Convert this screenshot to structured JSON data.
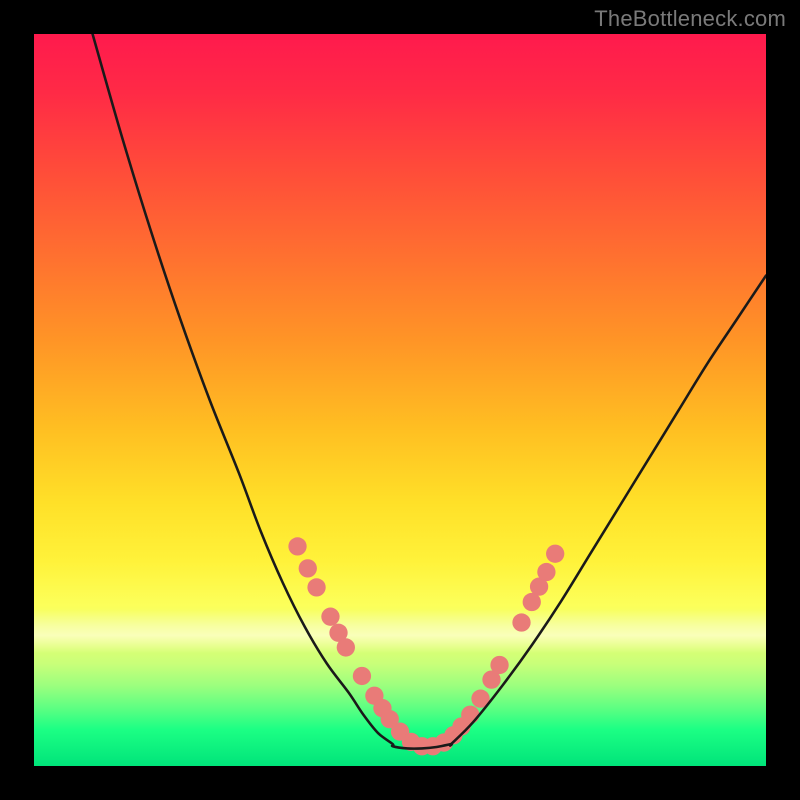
{
  "watermark": "TheBottleneck.com",
  "colors": {
    "dot_fill": "#e97b78",
    "curve_stroke": "#1a1a1a"
  },
  "chart_data": {
    "type": "line",
    "title": "",
    "xlabel": "",
    "ylabel": "",
    "xlim": [
      0,
      100
    ],
    "ylim": [
      0,
      100
    ],
    "note": "No numeric axis ticks or labels are rendered; values are approximate pixel-space percentages of the plot area (0,0 = top-left, 100,100 = bottom-right).",
    "series": [
      {
        "name": "left-curve",
        "x": [
          8,
          12,
          16,
          20,
          24,
          28,
          31,
          34,
          37,
          40,
          43,
          45,
          47,
          49
        ],
        "y": [
          0,
          14,
          27,
          39,
          50,
          60,
          68,
          75,
          81,
          86,
          90,
          93,
          95.5,
          97
        ]
      },
      {
        "name": "valley-floor",
        "x": [
          49,
          51,
          53,
          55,
          57
        ],
        "y": [
          97.3,
          97.6,
          97.6,
          97.4,
          97
        ]
      },
      {
        "name": "right-curve",
        "x": [
          57,
          60,
          64,
          68,
          72,
          76,
          80,
          84,
          88,
          92,
          96,
          100
        ],
        "y": [
          97,
          94,
          89,
          83.5,
          77.5,
          71,
          64.5,
          58,
          51.5,
          45,
          39,
          33
        ]
      }
    ],
    "dots": {
      "name": "highlighted-points",
      "points": [
        [
          36.0,
          70.0
        ],
        [
          37.4,
          73.0
        ],
        [
          38.6,
          75.6
        ],
        [
          40.5,
          79.6
        ],
        [
          41.6,
          81.8
        ],
        [
          42.6,
          83.8
        ],
        [
          44.8,
          87.7
        ],
        [
          46.5,
          90.4
        ],
        [
          47.6,
          92.1
        ],
        [
          48.6,
          93.6
        ],
        [
          50.0,
          95.3
        ],
        [
          51.5,
          96.7
        ],
        [
          53.0,
          97.3
        ],
        [
          54.5,
          97.3
        ],
        [
          56.0,
          96.8
        ],
        [
          57.3,
          95.8
        ],
        [
          58.4,
          94.6
        ],
        [
          59.6,
          93.0
        ],
        [
          61.0,
          90.8
        ],
        [
          62.5,
          88.2
        ],
        [
          63.6,
          86.2
        ],
        [
          66.6,
          80.4
        ],
        [
          68.0,
          77.6
        ],
        [
          69.0,
          75.5
        ],
        [
          70.0,
          73.5
        ],
        [
          71.2,
          71.0
        ]
      ],
      "radius_pct": 1.25
    }
  }
}
